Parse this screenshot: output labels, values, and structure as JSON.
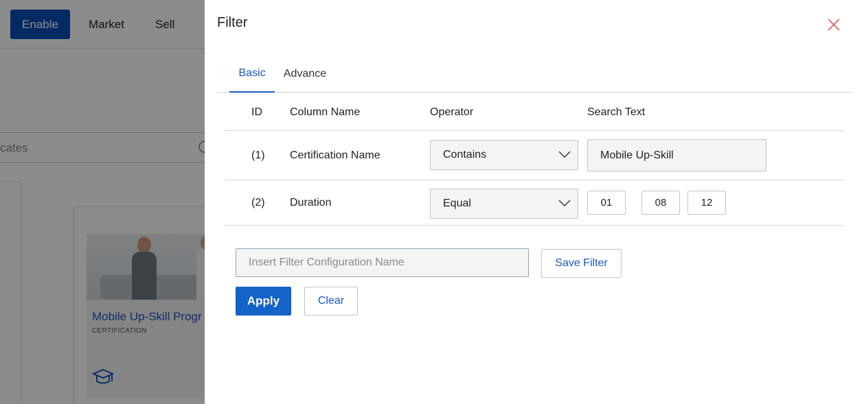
{
  "background": {
    "nav": {
      "enable_label": "Enable",
      "market_label": "Market",
      "sell_label": "Sell"
    },
    "search_fragment": "cates",
    "card": {
      "title": "Mobile Up-Skill Progr",
      "type": "CERTIFICATION",
      "icon": "graduation-cap-icon"
    }
  },
  "filter": {
    "title": "Filter",
    "close_icon": "close-icon",
    "tabs": [
      {
        "label": "Basic",
        "active": true
      },
      {
        "label": "Advance",
        "active": false
      }
    ],
    "columns": {
      "id": "ID",
      "column_name": "Column Name",
      "operator": "Operator",
      "search_text": "Search Text"
    },
    "rows": [
      {
        "id": "(1)",
        "column_name": "Certification Name",
        "operator": "Contains",
        "search_text": "Mobile Up-Skill"
      },
      {
        "id": "(2)",
        "column_name": "Duration",
        "operator": "Equal",
        "duration": [
          "01",
          "08",
          "12"
        ]
      }
    ],
    "config_name_placeholder": "Insert Filter Configuration Name",
    "config_name_value": "",
    "save_filter_label": "Save Filter",
    "apply_label": "Apply",
    "clear_label": "Clear"
  },
  "colors": {
    "accent": "#1b56c2",
    "primary_button": "#1463c8",
    "enable_button": "#0a4bb5",
    "close_icon": "#e05a5a"
  }
}
